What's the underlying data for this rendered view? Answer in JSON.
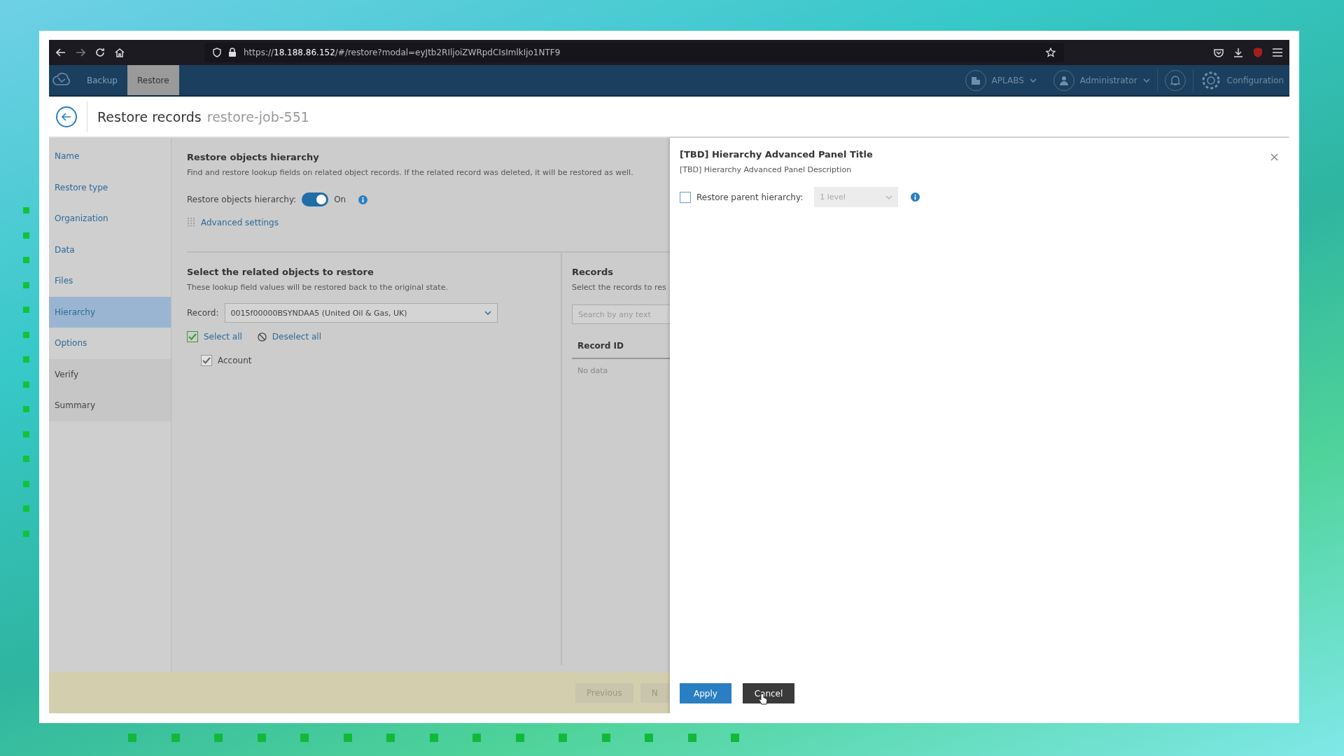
{
  "browser": {
    "url": "https://**18.188.86.152**/#/restore?modal=eyJtb2RIljoiZWRpdCIsImlkIjo1NTF9"
  },
  "app_header": {
    "tabs": [
      {
        "label": "Backup",
        "selected": false
      },
      {
        "label": "Restore",
        "selected": true
      }
    ],
    "organization": "APLABS",
    "user": "Administrator",
    "configuration": "Configuration"
  },
  "page": {
    "title": "Restore records",
    "job": "restore-job-551"
  },
  "steps": [
    {
      "label": "Name",
      "selected": false,
      "disabled": false
    },
    {
      "label": "Restore type",
      "selected": false,
      "disabled": false
    },
    {
      "label": "Organization",
      "selected": false,
      "disabled": false
    },
    {
      "label": "Data",
      "selected": false,
      "disabled": false
    },
    {
      "label": "Files",
      "selected": false,
      "disabled": false
    },
    {
      "label": "Hierarchy",
      "selected": true,
      "disabled": false
    },
    {
      "label": "Options",
      "selected": false,
      "disabled": false
    },
    {
      "label": "Verify",
      "selected": false,
      "disabled": true
    },
    {
      "label": "Summary",
      "selected": false,
      "disabled": true
    }
  ],
  "hierarchy": {
    "title": "Restore objects hierarchy",
    "description": "Find and restore lookup fields on related object records. If the related record was deleted, it will be restored as well.",
    "toggle_label": "Restore objects hierarchy:",
    "toggle_on": true,
    "toggle_text": "On",
    "advanced_settings": "Advanced settings"
  },
  "related": {
    "title": "Select the related objects to restore",
    "description": "These lookup field values will be restored back to the original state.",
    "record_label": "Record:",
    "record_value": "0015f00000BSYNDAA5 (United Oil & Gas, UK)",
    "select_all": "Select all",
    "select_all_checked": true,
    "deselect_all": "Deselect all",
    "objects": [
      {
        "label": "Account",
        "checked": true
      }
    ]
  },
  "records": {
    "title": "Records",
    "description": "Select the records to res",
    "search_placeholder": "Search by any text",
    "columns": [
      "Record ID"
    ],
    "empty": "No data"
  },
  "footer": {
    "buttons": [
      "Previous",
      "N"
    ]
  },
  "panel": {
    "title": "[TBD] Hierarchy Advanced Panel Title",
    "description": "[TBD] Hierarchy Advanced Panel Description",
    "parent_hierarchy": {
      "checked": false,
      "label": "Restore parent hierarchy:",
      "value": "1 level"
    },
    "buttons": [
      {
        "label": "Apply",
        "kind": "primary"
      },
      {
        "label": "Cancel",
        "kind": "secondary"
      }
    ]
  }
}
